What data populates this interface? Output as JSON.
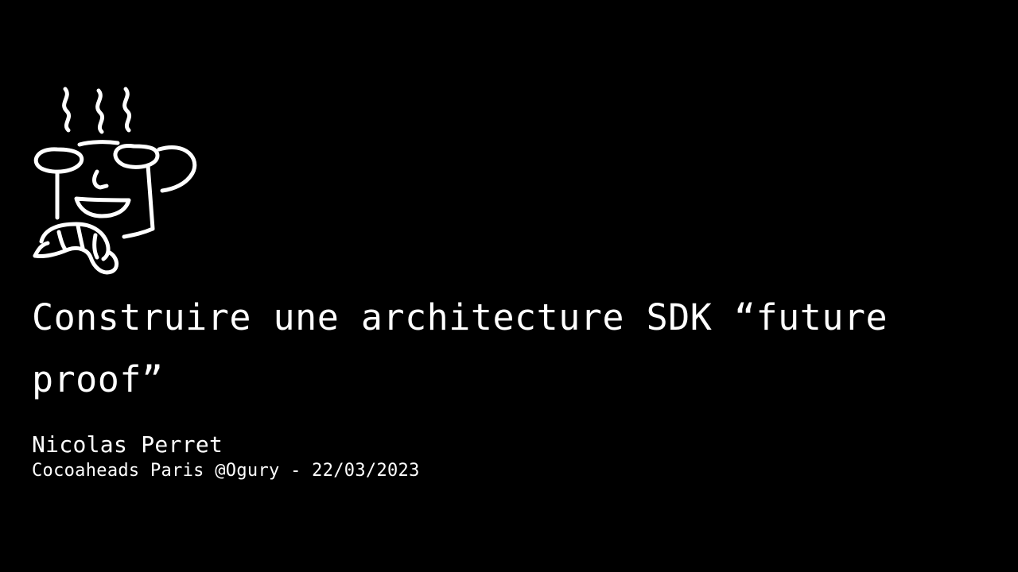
{
  "slide": {
    "title": "Construire une architecture SDK “future proof”",
    "author": "Nicolas Perret",
    "event": "Cocoaheads Paris @Ogury - 22/03/2023",
    "logo_icon": "coffee-mug-with-croissant-icon",
    "background_color": "#000000",
    "text_color": "#ffffff"
  }
}
